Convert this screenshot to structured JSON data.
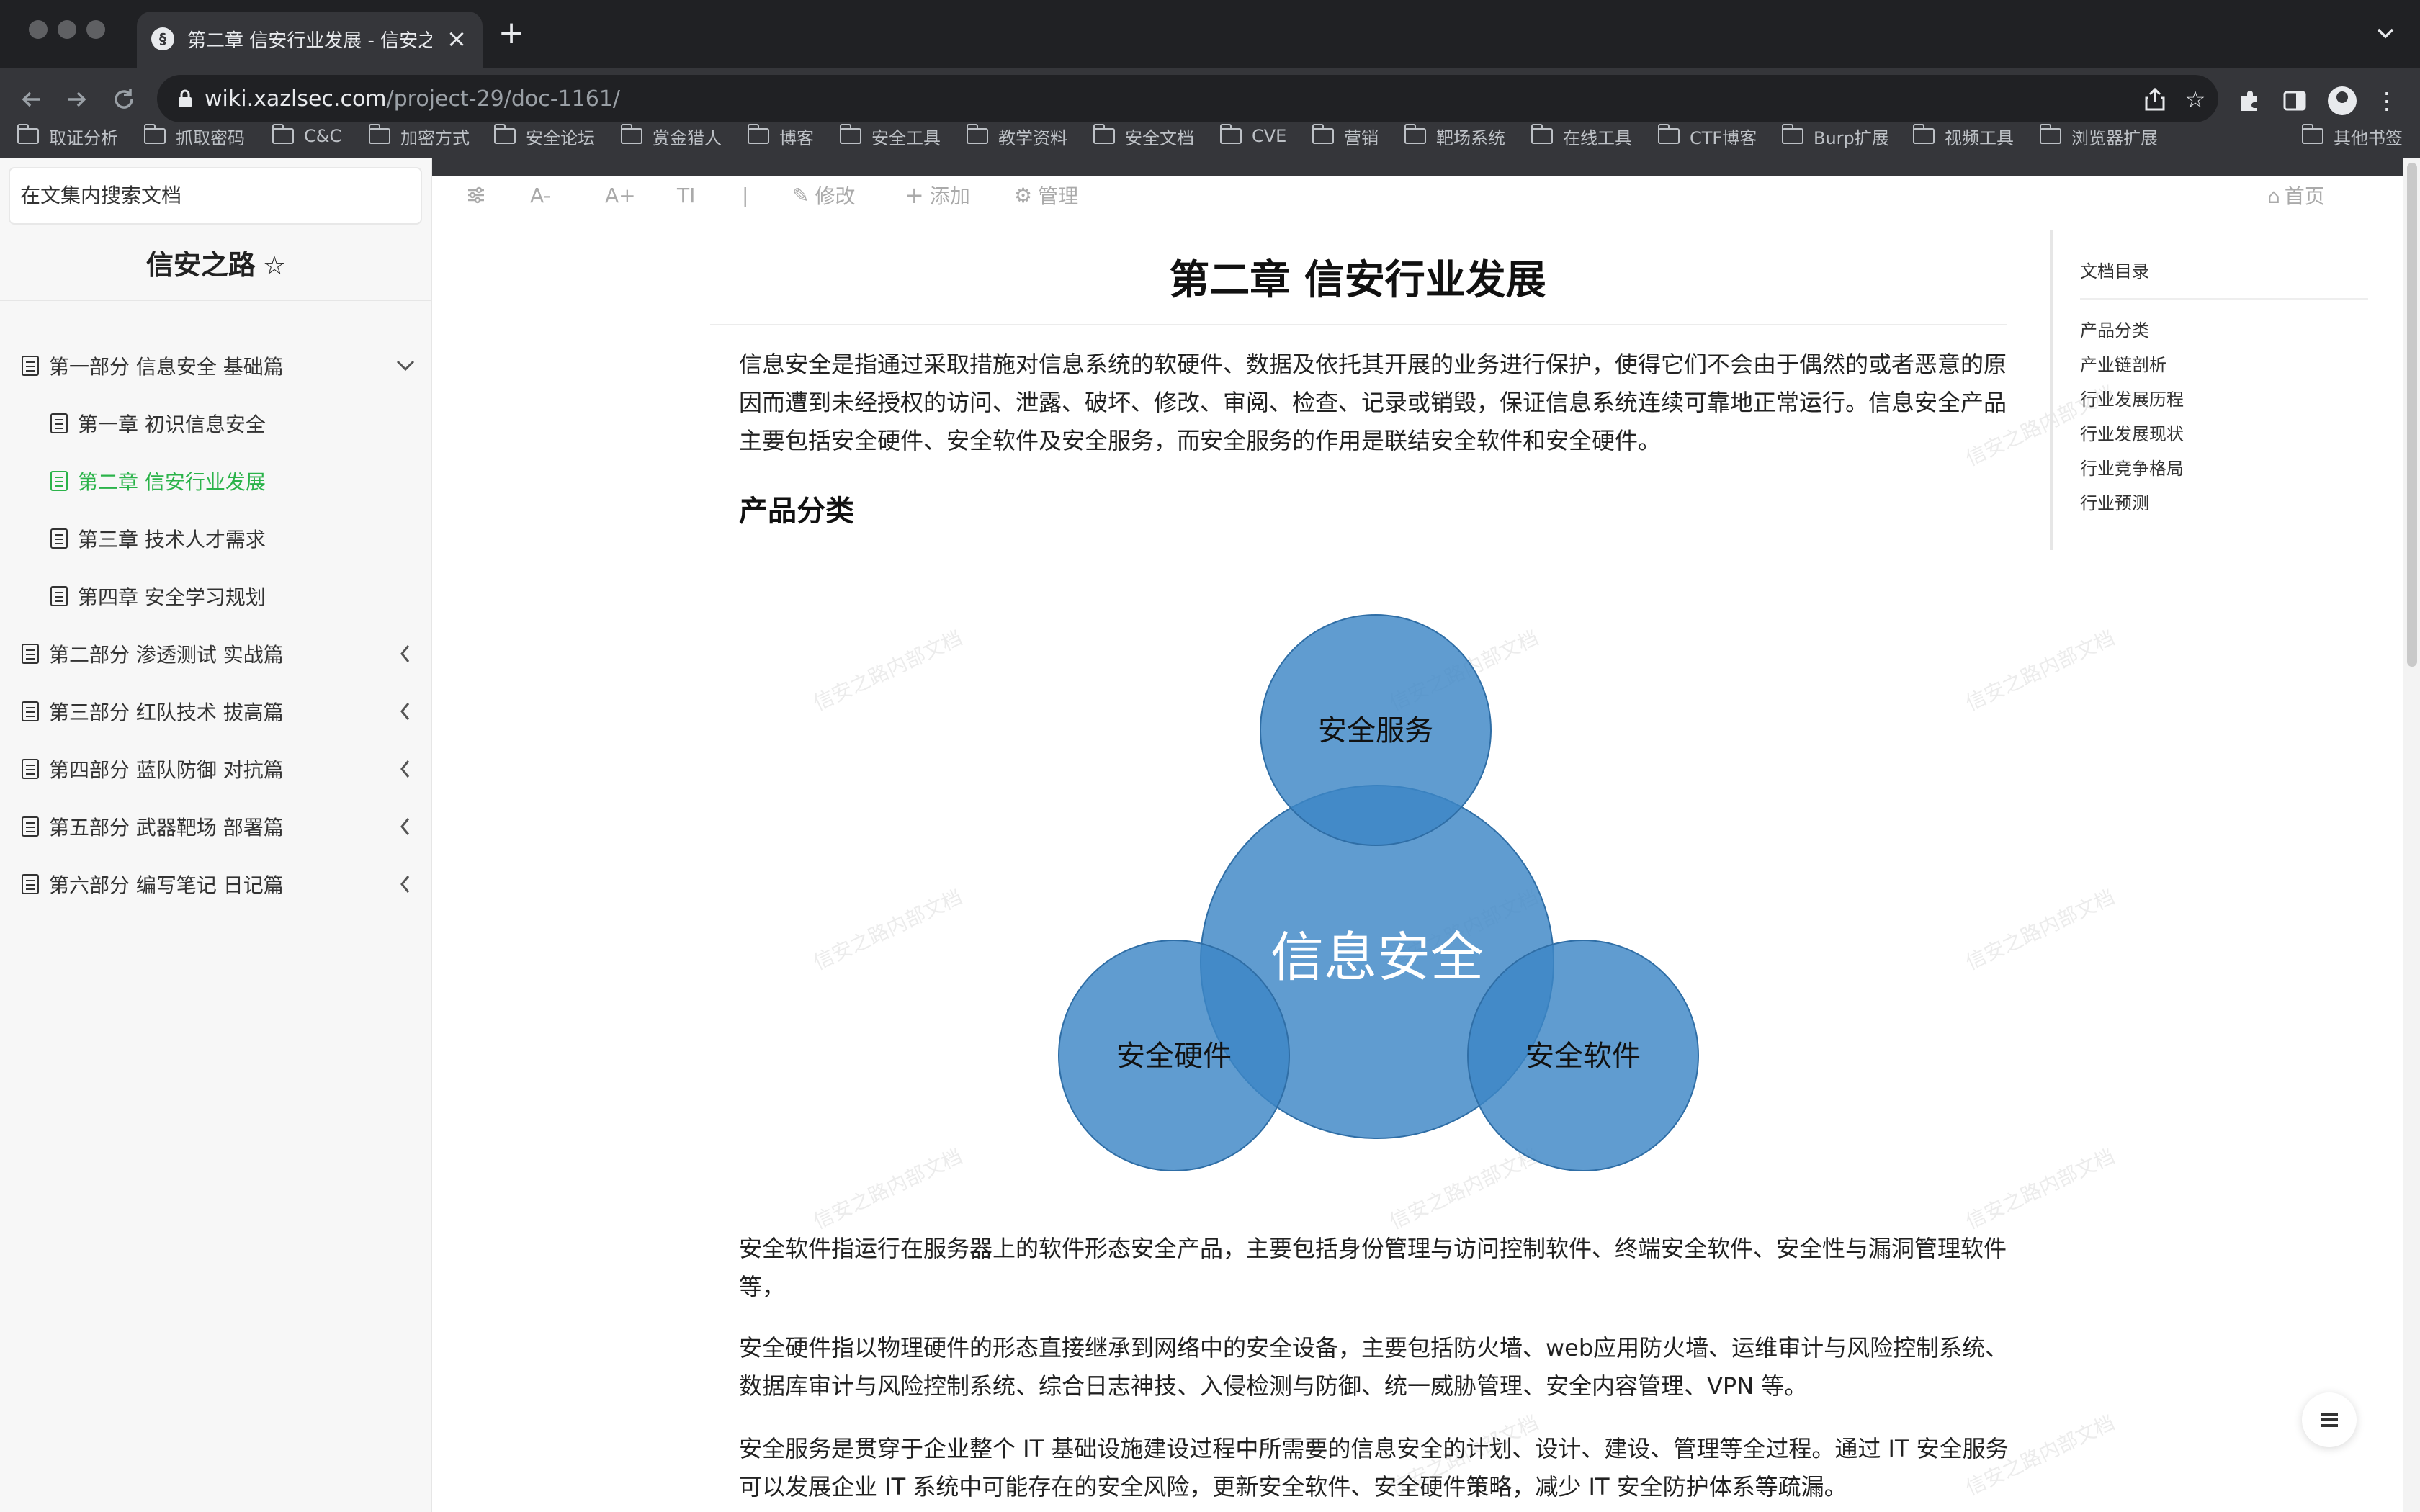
{
  "browser": {
    "tab_title": "第二章 信安行业发展 - 信安之路",
    "tab_close": "×",
    "new_tab": "+",
    "url_host": "wiki.xazlsec.com",
    "url_path": "/project-29/doc-1161/",
    "bookmarks": [
      "取证分析",
      "抓取密码",
      "C&C",
      "加密方式",
      "安全论坛",
      "赏金猎人",
      "博客",
      "安全工具",
      "教学资料",
      "安全文档",
      "CVE",
      "营销",
      "靶场系统",
      "在线工具",
      "CTF博客",
      "Burp扩展",
      "视频工具",
      "浏览器扩展"
    ],
    "other_bookmarks": "其他书签"
  },
  "sidebar": {
    "search_placeholder": "在文集内搜索文档",
    "book_title": "信安之路",
    "star_icon": "☆",
    "items": [
      {
        "label": "第一部分 信息安全 基础篇",
        "caret": "⌄"
      },
      {
        "label": "第一章 初识信息安全"
      },
      {
        "label": "第二章 信安行业发展"
      },
      {
        "label": "第三章 技术人才需求"
      },
      {
        "label": "第四章 安全学习规划"
      },
      {
        "label": "第二部分 渗透测试 实战篇",
        "caret": "‹"
      },
      {
        "label": "第三部分 红队技术 拔高篇",
        "caret": "‹"
      },
      {
        "label": "第四部分 蓝队防御 对抗篇",
        "caret": "‹"
      },
      {
        "label": "第五部分 武器靶场 部署篇",
        "caret": "‹"
      },
      {
        "label": "第六部分 编写笔记 日记篇",
        "caret": "‹"
      }
    ]
  },
  "content_toolbar": {
    "font_decrease": "A-",
    "font_increase": "A+",
    "font_style": "TI",
    "separator": "|",
    "edit": "修改",
    "add": "添加",
    "manage": "管理",
    "home": "首页"
  },
  "article": {
    "title": "第二章 信安行业发展",
    "intro": "信息安全是指通过采取措施对信息系统的软硬件、数据及依托其开展的业务进行保护，使得它们不会由于偶然的或者恶意的原因而遭到未经授权的访问、泄露、破坏、修改、审阅、检查、记录或销毁，保证信息系统连续可靠地正常运行。信息安全产品主要包括安全硬件、安全软件及安全服务，而安全服务的作用是联结安全软件和安全硬件。",
    "section_heading": "产品分类",
    "diagram": {
      "center": "信息安全",
      "top": "安全服务",
      "left": "安全硬件",
      "right": "安全软件"
    },
    "software_para": "安全软件指运行在服务器上的软件形态安全产品，主要包括身份管理与访问控制软件、终端安全软件、安全性与漏洞管理软件等，",
    "hardware_para": "安全硬件指以物理硬件的形态直接继承到网络中的安全设备，主要包括防火墙、web应用防火墙、运维审计与风险控制系统、数据库审计与风险控制系统、综合日志神技、入侵检测与防御、统一威胁管理、安全内容管理、VPN 等。",
    "service_para": "安全服务是贯穿于企业整个 IT 基础设施建设过程中所需要的信息安全的计划、设计、建设、管理等全过程。通过 IT 安全服务可以发展企业 IT 系统中可能存在的安全风险，更新安全软件、安全硬件策略，减少 IT 安全防护体系等疏漏。"
  },
  "toc": {
    "title": "文档目录",
    "items": [
      "产品分类",
      "产业链剖析",
      "行业发展历程",
      "行业发展现状",
      "行业竞争格局",
      "行业预测"
    ]
  },
  "watermark": "信安之路内部文档",
  "colors": {
    "accent_green": "#2bb34a",
    "venn_fill": "#3d86c6",
    "venn_stroke": "#2f6ea6"
  }
}
